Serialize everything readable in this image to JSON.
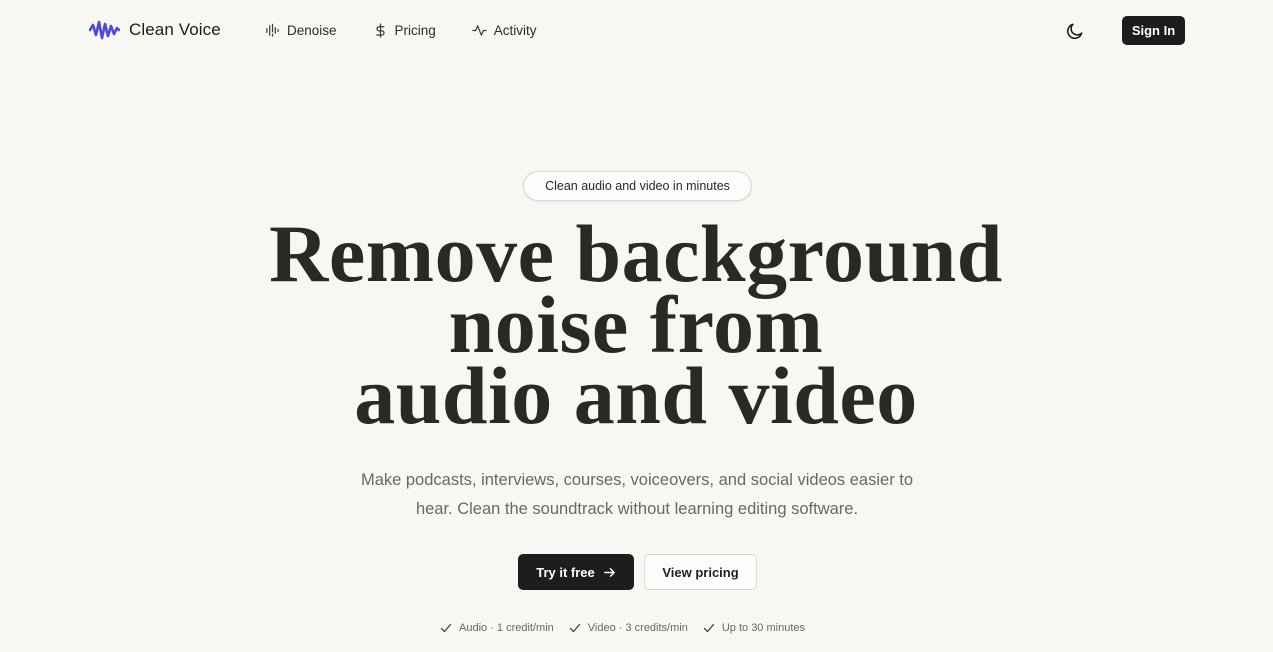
{
  "brand": {
    "name": "Clean Voice",
    "logo_icon": "waveform-icon",
    "accent": "#4a4ae0"
  },
  "nav": {
    "links": [
      {
        "label": "Denoise",
        "icon": "audio-lines-icon"
      },
      {
        "label": "Pricing",
        "icon": "dollar-icon"
      },
      {
        "label": "Activity",
        "icon": "activity-icon"
      }
    ],
    "theme_toggle_icon": "moon-icon",
    "signin_label": "Sign In"
  },
  "hero": {
    "badge": "Clean audio and video in minutes",
    "headline": [
      "Remove background",
      "noise from",
      "audio and video"
    ],
    "subtitle_lines": [
      "Make podcasts, interviews, courses, voiceovers, and social videos easier to",
      "hear. Clean the soundtrack without learning editing software."
    ],
    "cta_primary": "Try it free",
    "cta_primary_icon": "arrow-right-icon",
    "cta_secondary": "View pricing",
    "features": [
      "Audio · 1 credit/min",
      "Video · 3 credits/min",
      "Up to 30 minutes"
    ]
  },
  "colors": {
    "background": "#f8f7f4",
    "dark": "#1d1d1d",
    "muted_text": "#6a6864"
  }
}
